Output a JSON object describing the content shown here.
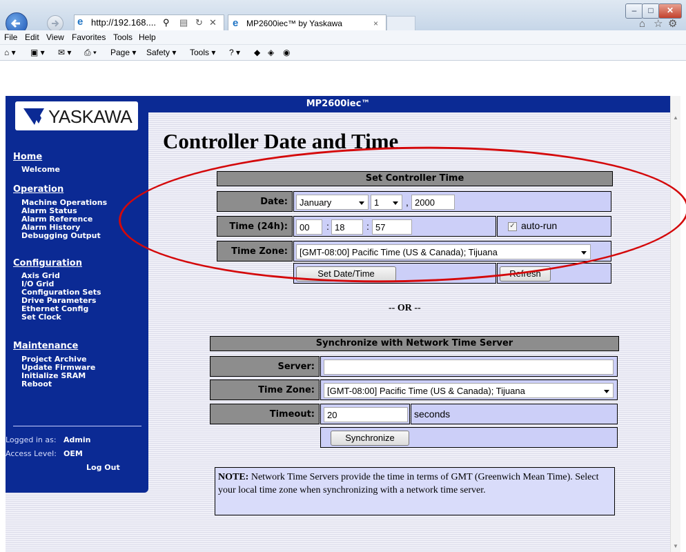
{
  "browser": {
    "address": "http://192.168....",
    "tab_title": "MP2600iec™ by Yaskawa",
    "menu": [
      "File",
      "Edit",
      "View",
      "Favorites",
      "Tools",
      "Help"
    ],
    "commands": [
      "Page ▾",
      "Safety ▾",
      "Tools ▾"
    ]
  },
  "page": {
    "banner": "MP2600iec™",
    "title": "Controller Date and Time",
    "logo_text": "YASKAWA"
  },
  "sidebar": {
    "sections": [
      {
        "heading": "Home",
        "items": [
          "Welcome"
        ]
      },
      {
        "heading": "Operation",
        "items": [
          "Machine Operations",
          "Alarm Status",
          "Alarm Reference",
          "Alarm History",
          "Debugging Output"
        ]
      },
      {
        "heading": "Configuration",
        "items": [
          "Axis Grid",
          "I/O Grid",
          "Configuration Sets",
          "Drive Parameters",
          "Ethernet Config",
          "Set Clock"
        ]
      },
      {
        "heading": "Maintenance",
        "items": [
          "Project Archive",
          "Update Firmware",
          "Initialize SRAM",
          "Reboot"
        ]
      }
    ],
    "logged_in_label": "Logged in as:",
    "logged_in_user": "Admin",
    "access_label": "Access Level:",
    "access_level": "OEM",
    "logout": "Log Out"
  },
  "set_time": {
    "heading": "Set Controller Time",
    "date_label": "Date:",
    "month": "January",
    "day": "1",
    "year": "2000",
    "comma": ",",
    "time_label": "Time (24h):",
    "hour": "00",
    "minute": "18",
    "second": "57",
    "colon": ":",
    "autorun_label": "auto-run",
    "autorun_checked": true,
    "tz_label": "Time Zone:",
    "timezone": "[GMT-08:00] Pacific Time (US & Canada); Tijuana",
    "set_button": "Set Date/Time",
    "refresh_button": "Refresh"
  },
  "or_text": "-- OR --",
  "sync": {
    "heading": "Synchronize with Network Time Server",
    "server_label": "Server:",
    "server_value": "",
    "tz_label": "Time Zone:",
    "timezone": "[GMT-08:00] Pacific Time (US & Canada); Tijuana",
    "timeout_label": "Timeout:",
    "timeout_value": "20",
    "timeout_unit": "seconds",
    "sync_button": "Synchronize"
  },
  "note": {
    "label": "NOTE:",
    "text": " Network Time Servers provide the time in terms of GMT (Greenwich Mean Time). Select your local time zone when synchronizing with a network time server."
  },
  "colors": {
    "nav_blue": "#0b2a94",
    "label_gray": "#8d8d8d",
    "cell_lavender": "#cccff8",
    "annotation_red": "#d4080a"
  }
}
